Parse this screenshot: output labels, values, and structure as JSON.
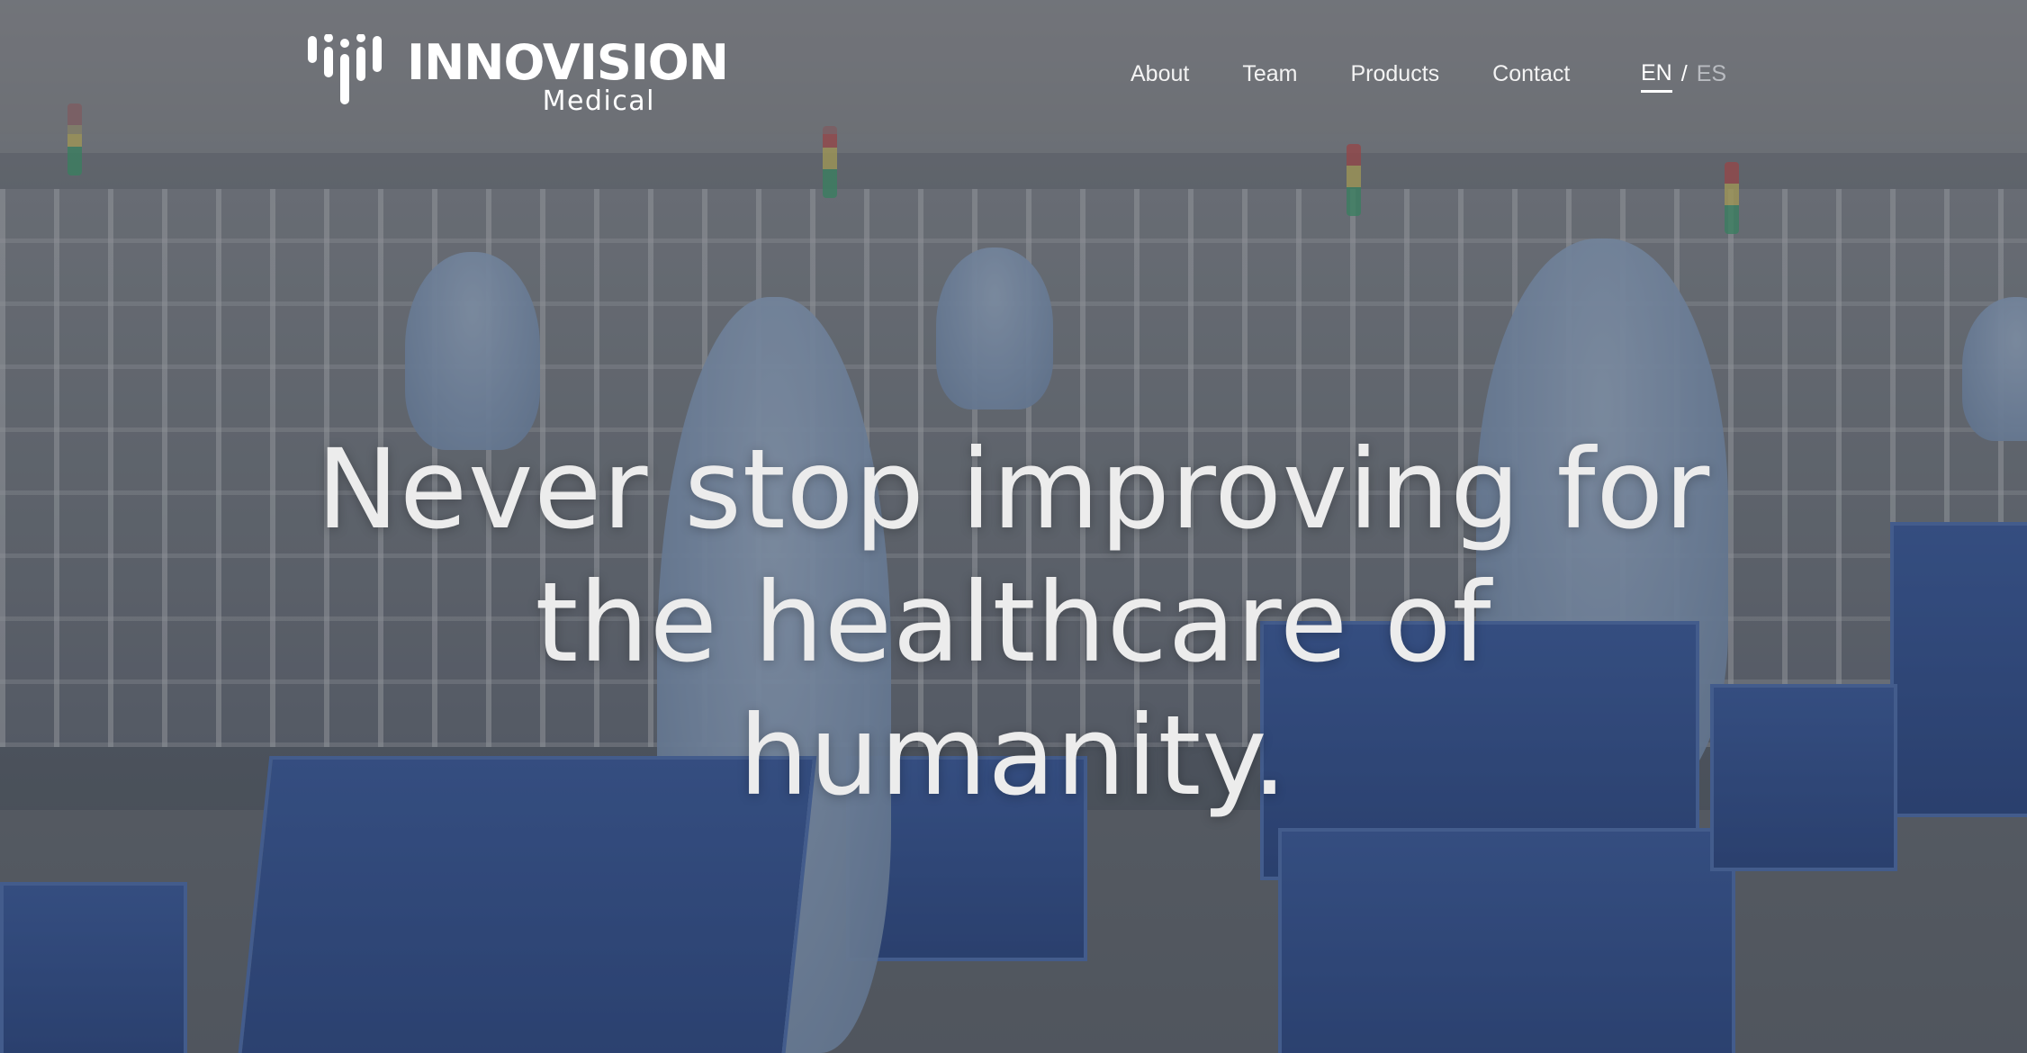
{
  "brand": {
    "name": "INNOVISION",
    "subtitle": "Medical",
    "logo_icon": "bars-mark-icon"
  },
  "nav": {
    "items": [
      {
        "label": "About"
      },
      {
        "label": "Team"
      },
      {
        "label": "Products"
      },
      {
        "label": "Contact"
      }
    ]
  },
  "language": {
    "current": "EN",
    "separator": "/",
    "alternate": "ES"
  },
  "hero": {
    "headline": "Never stop improving for the healthcare of humanity."
  },
  "colors": {
    "header_bg": "#6e7074",
    "text": "#ffffff",
    "inactive_lang": "#b9bcc1",
    "bins": "#2c4a8c"
  }
}
